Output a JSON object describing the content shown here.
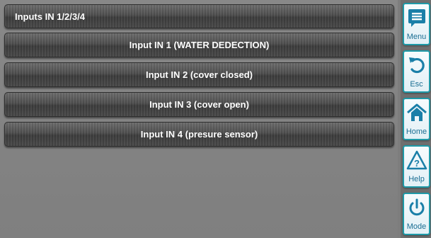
{
  "header": {
    "title": "Inputs IN 1/2/3/4"
  },
  "items": [
    {
      "label": "Input IN 1 (WATER DEDECTION)"
    },
    {
      "label": "Input IN 2 (cover closed)"
    },
    {
      "label": "Input IN 3 (cover open)"
    },
    {
      "label": "Input IN 4 (presure sensor)"
    }
  ],
  "sidebar": {
    "buttons": [
      {
        "label": "Menu",
        "icon": "menu-icon"
      },
      {
        "label": "Esc",
        "icon": "undo-icon"
      },
      {
        "label": "Home",
        "icon": "home-icon"
      },
      {
        "label": "Help",
        "icon": "warning-help-icon"
      },
      {
        "label": "Mode",
        "icon": "power-icon"
      }
    ]
  },
  "colors": {
    "accent": "#1f9aa8",
    "icon": "#1a7fa8",
    "bar_text": "#ffffff",
    "background": "#808080"
  }
}
